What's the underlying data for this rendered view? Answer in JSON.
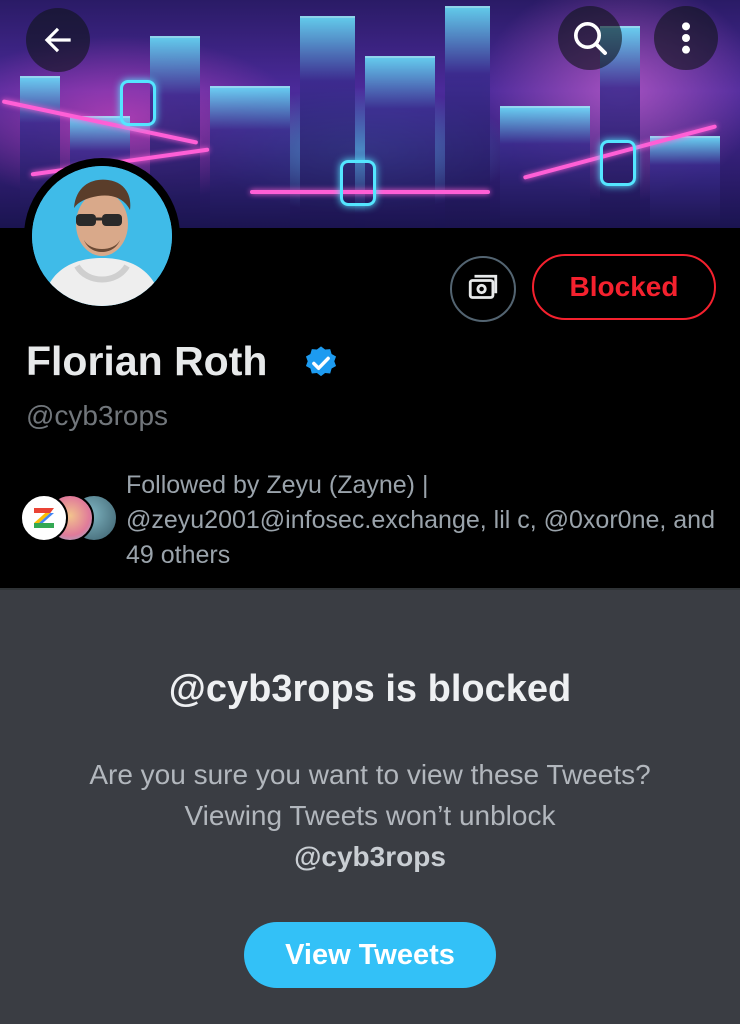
{
  "header": {
    "back_icon": "arrow-left-icon",
    "search_icon": "search-icon",
    "more_icon": "more-vertical-icon"
  },
  "profile": {
    "name": "Florian Roth",
    "handle": "@cyb3rops",
    "verified": true,
    "blocked_label": "Blocked",
    "tip_icon": "money-icon",
    "followed_by": "Followed by Zeyu (Zayne) | @zeyu2001@infosec.exchange, lil c, @0xor0ne, and 49 others"
  },
  "blocked_notice": {
    "title": "@cyb3rops is blocked",
    "message_prefix": "Are you sure you want to view these Tweets? Viewing Tweets won’t unblock",
    "message_handle": "@cyb3rops",
    "button_label": "View Tweets"
  },
  "colors": {
    "accent": "#1d9bf0",
    "danger": "#f4212e",
    "button": "#33c1f7"
  }
}
